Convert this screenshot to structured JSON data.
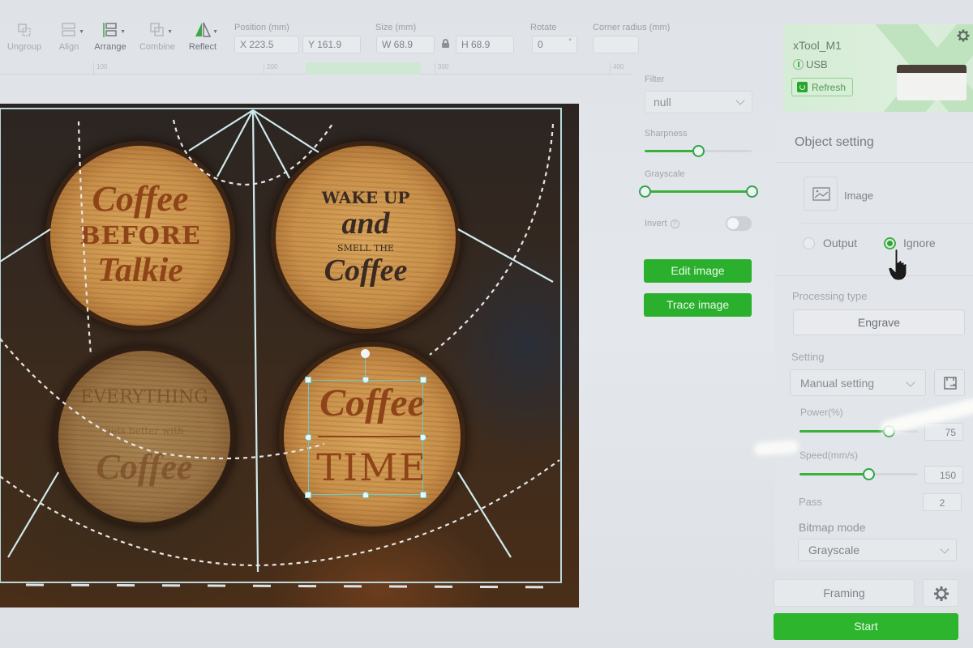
{
  "toolbar": {
    "tools": [
      {
        "label": "Ungroup",
        "icon": "ungroup-icon",
        "enabled": false
      },
      {
        "label": "Align",
        "icon": "align-icon",
        "enabled": false
      },
      {
        "label": "Arrange",
        "icon": "arrange-icon",
        "enabled": true
      },
      {
        "label": "Combine",
        "icon": "combine-icon",
        "enabled": false
      },
      {
        "label": "Reflect",
        "icon": "reflect-icon",
        "enabled": true
      }
    ],
    "position_label": "Position (mm)",
    "x_value": "X 223.5",
    "y_value": "Y 161.9",
    "size_label": "Size (mm)",
    "w_value": "W 68.9",
    "h_value": "H 68.9",
    "rotate_label": "Rotate",
    "rotate_value": "0",
    "rotate_unit": "°",
    "corner_label": "Corner radius (mm)",
    "corner_value": ""
  },
  "ruler": {
    "labels": [
      "100",
      "200",
      "300",
      "400"
    ]
  },
  "canvas": {
    "slices": [
      {
        "lines": [
          "Coffee",
          "BEFORE",
          "Talkie"
        ]
      },
      {
        "lines": [
          "WAKE UP",
          "and",
          "SMELL THE",
          "Coffee"
        ]
      },
      {
        "lines": [
          "EVERYTHING",
          "gets better with",
          "Coffee"
        ]
      },
      {
        "lines": [
          "Coffee",
          "TIME"
        ]
      }
    ]
  },
  "image_panel": {
    "filter_label": "Filter",
    "filter_value": "null",
    "sharpness_label": "Sharpness",
    "sharpness_value": 0.5,
    "grayscale_label": "Grayscale",
    "grayscale_range": [
      0,
      1
    ],
    "invert_label": "Invert",
    "invert_on": false,
    "edit_image_label": "Edit image",
    "trace_image_label": "Trace image"
  },
  "device": {
    "name": "xTool_M1",
    "connection": "USB",
    "refresh_label": "Refresh"
  },
  "object_setting": {
    "title": "Object setting",
    "type_label": "Image",
    "output_label": "Output",
    "ignore_label": "Ignore",
    "selected": "Ignore",
    "processing_type_label": "Processing type",
    "processing_type_value": "Engrave",
    "setting_label": "Setting",
    "setting_value": "Manual setting",
    "power_label": "Power(%)",
    "power_value": "75",
    "power_fraction": 0.75,
    "speed_label": "Speed(mm/s)",
    "speed_value": "150",
    "speed_fraction": 0.58,
    "pass_label": "Pass",
    "pass_value": "2",
    "bitmap_mode_label": "Bitmap mode",
    "bitmap_mode_value": "Grayscale"
  },
  "footer": {
    "framing_label": "Framing",
    "start_label": "Start"
  },
  "colors": {
    "accent": "#2db52d",
    "selection": "#6fc6c2"
  }
}
